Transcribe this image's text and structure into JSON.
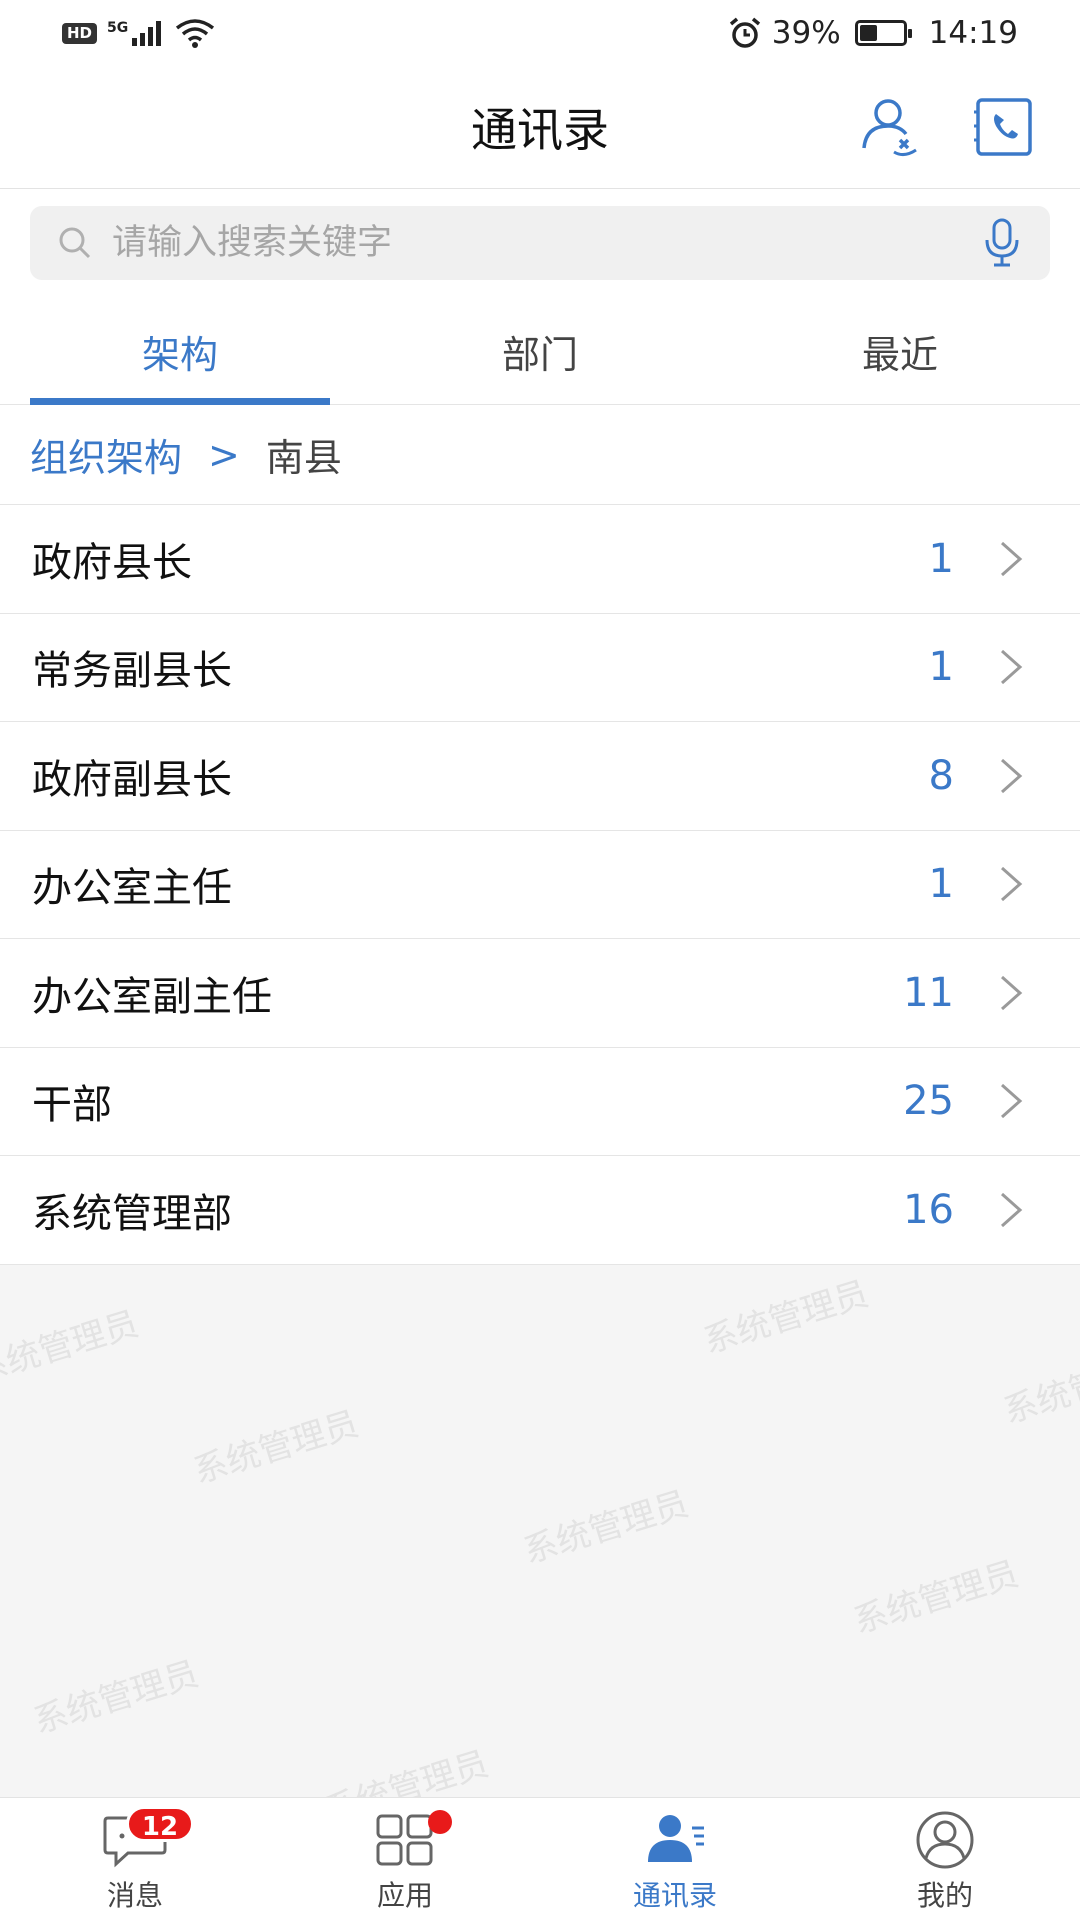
{
  "status_bar": {
    "hd": "HD",
    "network": "5G",
    "battery_percent": "39%",
    "battery_level": 0.39,
    "time": "14:19"
  },
  "header": {
    "title": "通讯录",
    "icons": [
      "contact-remove-icon",
      "phonebook-icon"
    ]
  },
  "search": {
    "placeholder": "请输入搜索关键字",
    "value": ""
  },
  "tabs": [
    {
      "label": "架构",
      "active": true
    },
    {
      "label": "部门",
      "active": false
    },
    {
      "label": "最近",
      "active": false
    }
  ],
  "breadcrumb": {
    "root": "组织架构",
    "separator": ">",
    "current": "南县"
  },
  "departments": [
    {
      "name": "政府县长",
      "count": "1"
    },
    {
      "name": "常务副县长",
      "count": "1"
    },
    {
      "name": "政府副县长",
      "count": "8"
    },
    {
      "name": "办公室主任",
      "count": "1"
    },
    {
      "name": "办公室副主任",
      "count": "11"
    },
    {
      "name": "干部",
      "count": "25"
    },
    {
      "name": "系统管理部",
      "count": "16"
    }
  ],
  "watermark": "系统管理员",
  "bottom_nav": [
    {
      "label": "消息",
      "badge": "12",
      "icon": "chat-icon"
    },
    {
      "label": "应用",
      "badge_dot": true,
      "icon": "apps-grid-icon"
    },
    {
      "label": "通讯录",
      "active": true,
      "icon": "contacts-icon"
    },
    {
      "label": "我的",
      "icon": "profile-icon"
    }
  ],
  "colors": {
    "accent": "#3b79c8",
    "badge": "#e81a1a",
    "background": "#f5f5f5"
  }
}
